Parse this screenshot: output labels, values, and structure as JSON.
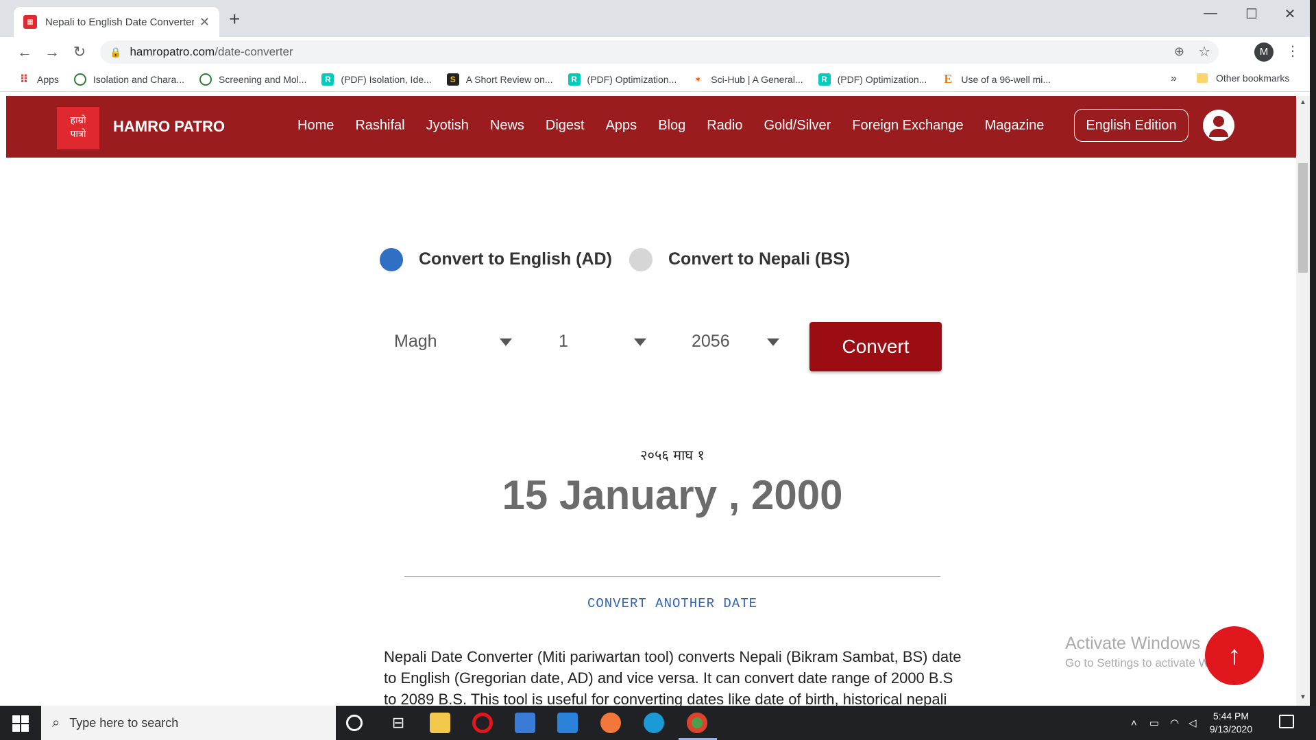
{
  "browser": {
    "tab_title": "Nepali to English Date Converter",
    "url_domain": "hamropatro.com",
    "url_path": "/date-converter",
    "profile_initial": "M",
    "bookmarks": [
      {
        "label": "Apps",
        "icon": "apps-grid-icon",
        "color": "#ea4335"
      },
      {
        "label": "Isolation and Chara...",
        "icon": "scilit-icon",
        "color": "#2e7d32"
      },
      {
        "label": "Screening and Mol...",
        "icon": "scilit-icon",
        "color": "#2e7d32"
      },
      {
        "label": "(PDF) Isolation, Ide...",
        "icon": "researchgate-icon",
        "color": "#00ccbb"
      },
      {
        "label": "A Short Review on...",
        "icon": "sematic-icon",
        "color": "#222222"
      },
      {
        "label": "(PDF) Optimization...",
        "icon": "researchgate-icon",
        "color": "#00ccbb"
      },
      {
        "label": "Sci-Hub | A General...",
        "icon": "scihub-icon",
        "color": "#e65100"
      },
      {
        "label": "(PDF) Optimization...",
        "icon": "researchgate-icon",
        "color": "#00ccbb"
      },
      {
        "label": "Use of a 96-well mi...",
        "icon": "elsevier-icon",
        "color": "#f57c00"
      }
    ],
    "more_label": "»",
    "other_bookmarks": "Other bookmarks"
  },
  "site": {
    "brand": "HAMRO PATRO",
    "logo_text_line1": "हाम्रो",
    "logo_text_line2": "पात्रो",
    "nav": [
      "Home",
      "Rashifal",
      "Jyotish",
      "News",
      "Digest",
      "Apps",
      "Blog",
      "Radio",
      "Gold/Silver",
      "Foreign Exchange",
      "Magazine"
    ],
    "edition_button": "English Edition",
    "header_color": "#9b1c1f"
  },
  "converter": {
    "option_ad": "Convert to English (AD)",
    "option_bs": "Convert to Nepali (BS)",
    "selected_option": "ad",
    "month": "Magh",
    "day": "1",
    "year": "2056",
    "convert_label": "Convert",
    "result_nepali": "२०५६ माघ १",
    "result_english": "15 January , 2000",
    "another_label": "CONVERT ANOTHER DATE",
    "description": "Nepali Date Converter (Miti pariwartan tool) converts Nepali (Bikram Sambat, BS) date to English (Gregorian date, AD) and vice versa. It can convert date range of 2000 B.S to 2089 B.S. This tool is useful for converting dates like date of birth, historical nepali"
  },
  "watermark": {
    "line1": "Activate Windows",
    "line2": "Go to Settings to activate Windows."
  },
  "taskbar": {
    "search_placeholder": "Type here to search",
    "time": "5:44 PM",
    "date": "9/13/2020"
  }
}
